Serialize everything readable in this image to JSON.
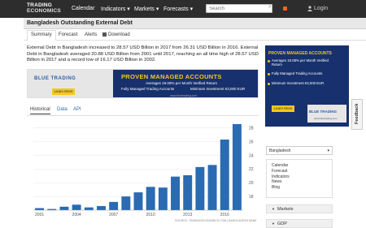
{
  "nav": {
    "logo_line1": "TRADING",
    "logo_line2": "ECONOMICS",
    "items": [
      "Calendar",
      "Indicators",
      "Markets",
      "Forecasts"
    ],
    "search_placeholder": "Search",
    "login": "Login"
  },
  "page": {
    "title": "Bangladesh Outstanding External Debt",
    "tabs": [
      "Summary",
      "Forecast",
      "Alerts",
      "Download"
    ],
    "description": "External Debt in Bangladesh increased to 28.57 USD Billion in 2017 from 26.31 USD Billion in 2016. External Debt in Bangladesh averaged 20.88 USD Billion from 2001 until 2017, reaching an all time high of 28.57 USD Billion in 2017 and a record low of 16.17 USD Billion in 2002."
  },
  "banner": {
    "brand": "BLUE TRADING",
    "headline": "PROVEN MANAGED ACCOUNTS",
    "line1": "Averages 19.08% per Month Verified Return",
    "line2": "Fully Managed Trading Accounts",
    "line3": "Minimum Investment €3,000 EUR",
    "button": "Learn More",
    "url": "www.bluetrading.com"
  },
  "side_ad": {
    "headline": "PROVEN MANAGED ACCOUNTS",
    "item1": "Averages 19.08% per Month Verified Return",
    "item2": "Fully Managed Trading Accounts",
    "item3": "Minimum Investment €3,000 EUR",
    "button": "Learn More",
    "brand": "BLUE TRADING",
    "url": "www.bluetrading.com"
  },
  "chart_tabs": [
    "Historical",
    "Data",
    "API"
  ],
  "feedback": "Feedback",
  "source": "SOURCE: TRADINGECONOMICS.COM | BANGLADESH BANK",
  "sidebar": {
    "country": "Bangladesh",
    "links": [
      "Calendar",
      "Forecast",
      "Indicators",
      "News",
      "Blog"
    ],
    "sections": [
      "Markets",
      "GDP"
    ]
  },
  "colors": {
    "bar": "#2a6bb1",
    "navbar": "#2d2d2d",
    "ad_blue": "#17316e",
    "ad_gold": "#f7c71d"
  },
  "chart_data": {
    "type": "bar",
    "x": [
      2001,
      2002,
      2003,
      2004,
      2005,
      2006,
      2007,
      2008,
      2009,
      2010,
      2011,
      2012,
      2013,
      2014,
      2015,
      2016,
      2017
    ],
    "values": [
      16.3,
      16.17,
      16.5,
      16.8,
      16.4,
      16.6,
      17.2,
      18.0,
      18.6,
      19.4,
      19.3,
      20.9,
      21.1,
      22.3,
      22.6,
      26.31,
      28.57
    ],
    "x_ticks": [
      "2001",
      "2004",
      "2007",
      "2010",
      "2013",
      "2016"
    ],
    "y_ticks": [
      18,
      20,
      22,
      24,
      26,
      28
    ],
    "ylim": [
      16,
      28.8
    ]
  }
}
